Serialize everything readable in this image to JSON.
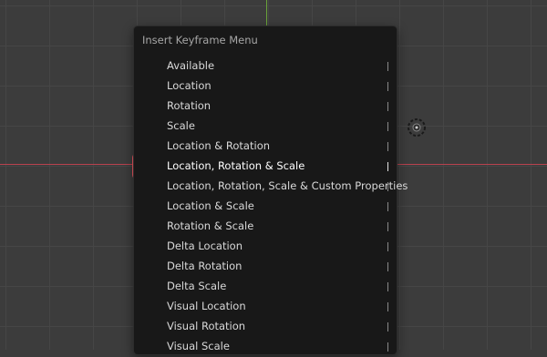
{
  "menu": {
    "title": "Insert Keyframe Menu",
    "items": [
      {
        "label": "Available"
      },
      {
        "label": "Location"
      },
      {
        "label": "Rotation"
      },
      {
        "label": "Scale"
      },
      {
        "label": "Location & Rotation"
      },
      {
        "label": "Location, Rotation & Scale",
        "highlighted": true
      },
      {
        "label": "Location, Rotation, Scale & Custom Properties"
      },
      {
        "label": "Location & Scale"
      },
      {
        "label": "Rotation & Scale"
      },
      {
        "label": "Delta Location"
      },
      {
        "label": "Delta Rotation"
      },
      {
        "label": "Delta Scale"
      },
      {
        "label": "Visual Location"
      },
      {
        "label": "Visual Rotation"
      },
      {
        "label": "Visual Scale"
      }
    ]
  },
  "colors": {
    "viewport_bg": "#3c3c3c",
    "x_axis": "#b9424f",
    "y_axis": "#6aa33a",
    "menu_bg": "#181818",
    "highlight_fill": "#4772b3",
    "highlight_ring": "#f05a64"
  }
}
